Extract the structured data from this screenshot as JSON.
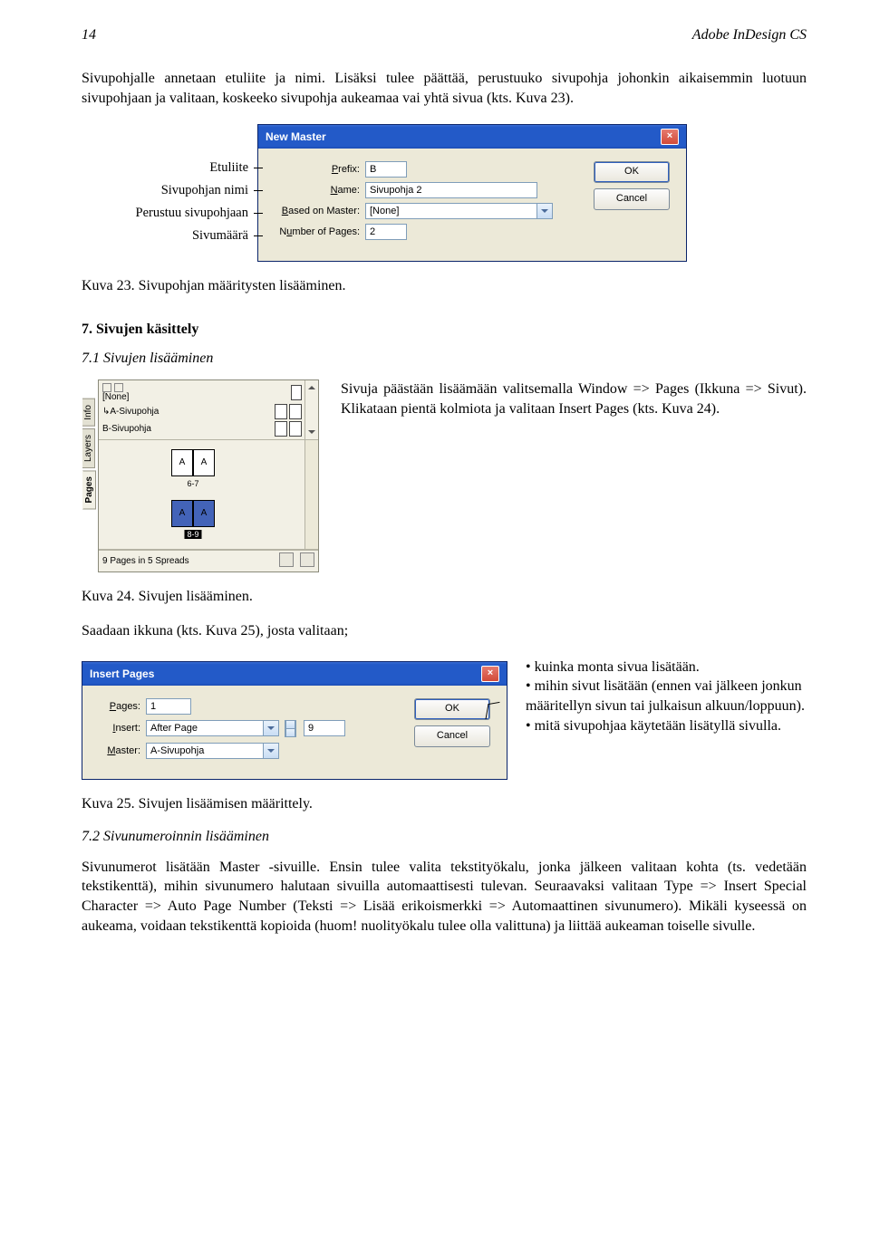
{
  "header": {
    "page_num": "14",
    "title": "Adobe InDesign CS"
  },
  "intro": "Sivupohjalle annetaan etuliite ja nimi. Lisäksi tulee päättää, perustuuko sivupohja johonkin aikaisemmin luotuun sivupohjaan ja valitaan, koskeeko sivupohja aukeamaa vai yhtä sivua (kts. Kuva 23).",
  "callouts": {
    "a": "Etuliite",
    "b": "Sivupohjan nimi",
    "c": "Perustuu sivupohjaan",
    "d": "Sivumäärä"
  },
  "newMaster": {
    "title": "New Master",
    "labels": {
      "prefix": "Prefix:",
      "name": "Name:",
      "based": "Based on Master:",
      "num": "Number of Pages:"
    },
    "values": {
      "prefix": "B",
      "name": "Sivupohja 2",
      "based": "[None]",
      "num": "2"
    },
    "ok": "OK",
    "cancel": "Cancel",
    "close": "×"
  },
  "caption23": "Kuva 23. Sivupohjan määritysten lisääminen.",
  "h7": "7. Sivujen käsittely",
  "h71": "7.1 Sivujen lisääminen",
  "pagesPanel": {
    "none": "[None]",
    "a": "A-Sivupohja",
    "b": "B-Sivupohja",
    "tabInfo": "Info",
    "tabLayers": "Layers",
    "tabPages": "Pages",
    "spread1label": "6-7",
    "spread2label": "8-9",
    "spreadLetter": "A",
    "status": "9 Pages in 5 Spreads"
  },
  "para71": "Sivuja päästään lisäämään valitsemalla Window => Pages (Ikkuna => Sivut). Klikataan pientä kolmiota ja valitaan Insert Pages (kts. Kuva 24).",
  "caption24": "Kuva 24. Sivujen lisääminen.",
  "para25intro": "Saadaan ikkuna (kts. Kuva 25), josta valitaan;",
  "insertPages": {
    "title": "Insert Pages",
    "labels": {
      "pages": "Pages:",
      "insert": "Insert:",
      "master": "Master:"
    },
    "values": {
      "pages": "1",
      "insert": "After Page",
      "insertNum": "9",
      "master": "A-Sivupohja"
    },
    "ok": "OK",
    "cancel": "Cancel",
    "close": "×"
  },
  "bullets": {
    "b1": "kuinka monta sivua lisätään.",
    "b2": "mihin sivut lisätään (ennen vai jälkeen jonkun määritellyn sivun tai julkaisun alkuun/loppuun).",
    "b3": "mitä sivupohjaa käytetään lisätyllä sivulla."
  },
  "caption25": "Kuva 25. Sivujen lisäämisen määrittely.",
  "h72": "7.2 Sivunumeroinnin lisääminen",
  "para72": "Sivunumerot lisätään Master -sivuille. Ensin tulee valita tekstityökalu, jonka jälkeen valitaan kohta (ts. vedetään tekstikenttä), mihin sivunumero halutaan sivuilla automaattisesti tulevan. Seuraavaksi valitaan Type => Insert Special Character => Auto Page Number (Teksti => Lisää erikoismerkki => Automaattinen sivunumero). Mikäli kyseessä on aukeama, voidaan tekstikenttä kopioida (huom! nuolityökalu tulee olla valittuna) ja liittää aukeaman toiselle sivulle."
}
